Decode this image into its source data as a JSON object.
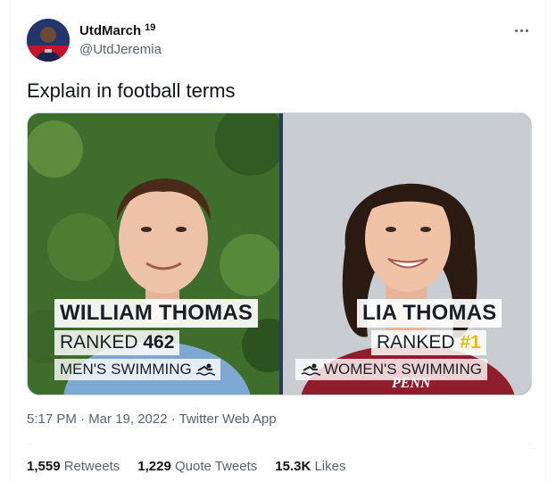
{
  "author": {
    "display_name": "UtdMarch",
    "badge": "19",
    "handle": "@UtdJeremia"
  },
  "tweet": {
    "text": "Explain in football terms",
    "timestamp": "5:17 PM · Mar 19, 2022 · Twitter Web App"
  },
  "media": {
    "left": {
      "name": "WILLIAM THOMAS",
      "rank_prefix": "RANKED",
      "rank_value": "462",
      "category": "MEN'S SWIMMING"
    },
    "right": {
      "name": "LIA THOMAS",
      "rank_prefix": "RANKED",
      "rank_value": "#1",
      "category": "WOMEN'S SWIMMING",
      "jersey_text": "PENN"
    }
  },
  "stats": {
    "retweets_count": "1,559",
    "retweets_label": "Retweets",
    "quotes_count": "1,229",
    "quotes_label": "Quote Tweets",
    "likes_count": "15.3K",
    "likes_label": "Likes"
  },
  "colors": {
    "accent_rank": "#f4b400",
    "text_secondary": "#536471"
  },
  "icons": {
    "more": "more-icon",
    "swim": "swimmer-icon"
  }
}
